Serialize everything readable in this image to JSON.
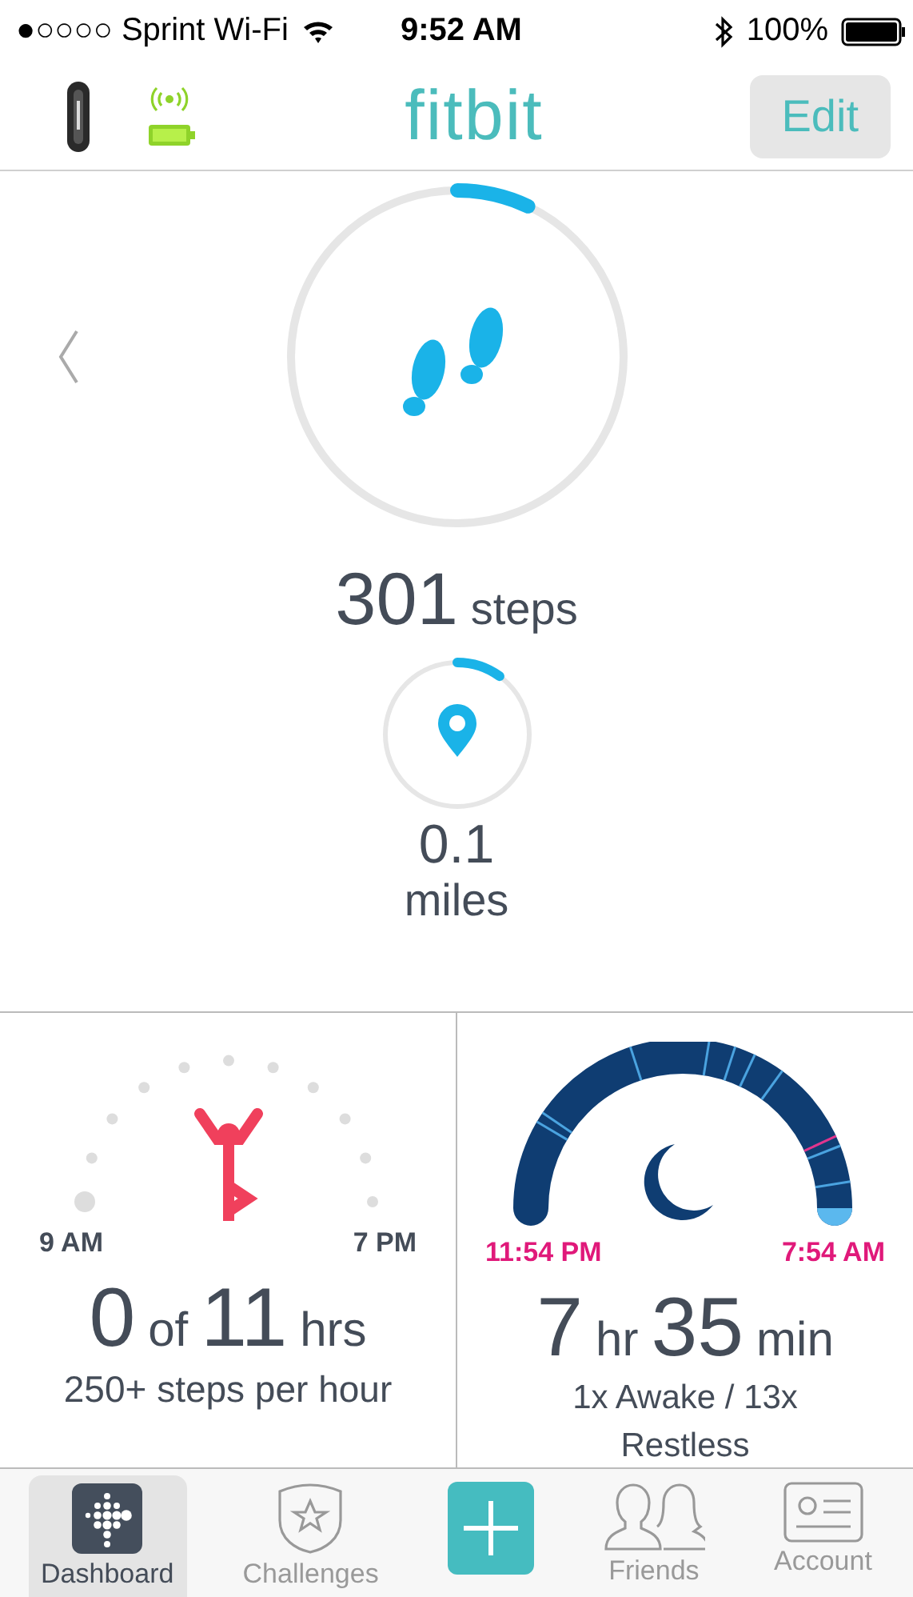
{
  "status_bar": {
    "carrier": "●○○○○ Sprint Wi-Fi",
    "time": "9:52 AM",
    "battery": "100%"
  },
  "header": {
    "logo": "fitbit",
    "edit_button": "Edit"
  },
  "steps": {
    "value": "301",
    "unit": "steps"
  },
  "distance": {
    "value": "0.1",
    "unit": "miles"
  },
  "hourly": {
    "start": "9 AM",
    "end": "7 PM",
    "value": "0",
    "of": "of",
    "goal": "11",
    "unit": "hrs",
    "caption": "250+ steps per hour"
  },
  "sleep": {
    "start": "11:54 PM",
    "end": "7:54 AM",
    "hours": "7",
    "hours_unit": "hr",
    "minutes": "35",
    "minutes_unit": "min",
    "caption": "1x Awake / 13x Restless"
  },
  "tabs": [
    {
      "kind": "dashboard",
      "label": "Dashboard",
      "selected": true
    },
    {
      "kind": "challenges",
      "label": "Challenges",
      "selected": false
    },
    {
      "kind": "add",
      "selected": false
    },
    {
      "kind": "friends",
      "label": "Friends",
      "selected": false
    },
    {
      "kind": "account",
      "label": "Account",
      "selected": false
    }
  ]
}
